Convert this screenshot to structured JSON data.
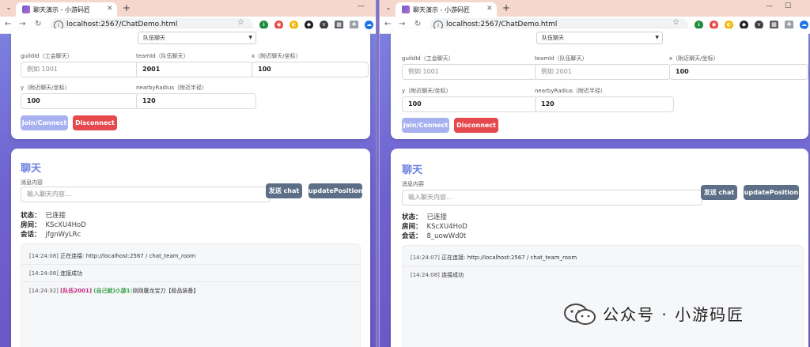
{
  "left": {
    "tab_title": "聊天演示 - 小游码匠",
    "url": "localhost:2567/ChatDemo.html",
    "form": {
      "channel_value": "队伍聊天",
      "guild_label": "guildId（工会聊天）",
      "guild_placeholder": "例如 1001",
      "team_label": "teamId（队伍聊天）",
      "team_value": "2001",
      "x_label": "x（附近聊天/坐标）",
      "x_value": "100",
      "y_label": "y（附近聊天/坐标）",
      "y_value": "100",
      "radius_label": "nearbyRadius（附近半径）",
      "radius_value": "120",
      "join_label": "Join/Connect",
      "disconnect_label": "Disconnect"
    },
    "chat": {
      "title": "聊天",
      "msg_label": "消息内容",
      "msg_placeholder": "输入聊天内容...",
      "send_label": "发送 chat",
      "update_label": "updatePosition",
      "status_key": "状态：",
      "status_val": "已连接",
      "room_key": "房间：",
      "room_val": "KScXU4HoD",
      "session_key": "会话：",
      "session_val": "jfgnWyLRc",
      "logs": [
        {
          "ts": "[14:24:08]",
          "text": "正在连接: http://localhost:2567 / chat_team_room"
        },
        {
          "ts": "[14:24:08]",
          "text": "连接成功"
        },
        {
          "ts": "[14:24:32]",
          "team": "[队伍2001]",
          "user": "(自己就)小游1:",
          "text": "刚刚屠龙宝刀【极品装备】"
        }
      ]
    }
  },
  "right": {
    "tab_title": "聊天演示 - 小游码匠",
    "url": "localhost:2567/ChatDemo.html",
    "form": {
      "channel_value": "队伍聊天",
      "guild_label": "guildId（工会聊天）",
      "guild_placeholder": "例如 1001",
      "team_label": "teamId（队伍聊天）",
      "team_placeholder": "例如 2001",
      "x_label": "x（附近聊天/坐标）",
      "x_value": "100",
      "y_label": "y（附近聊天/坐标）",
      "y_value": "100",
      "radius_label": "nearbyRadius（附近半径）",
      "radius_value": "120",
      "join_label": "Join/Connect",
      "disconnect_label": "Disconnect"
    },
    "chat": {
      "title": "聊天",
      "msg_label": "消息内容",
      "msg_placeholder": "输入聊天内容...",
      "send_label": "发送 chat",
      "update_label": "updatePosition",
      "status_key": "状态：",
      "status_val": "已连接",
      "room_key": "房间：",
      "room_val": "KScXU4HoD",
      "session_key": "会话：",
      "session_val": "8_uowWd0t",
      "logs": [
        {
          "ts": "[14:24:07]",
          "text": "正在连接: http://localhost:2567 / chat_team_room"
        },
        {
          "ts": "[14:24:08]",
          "text": "连接成功"
        }
      ]
    }
  },
  "watermark": "公众号 · 小游码匠",
  "colors": {
    "accent": "#6b7fe0",
    "join": "#a7b1f0",
    "disconnect": "#e5484d",
    "action": "#5d6f86",
    "tabbar": "#f6d7cd",
    "team": "#c0237c",
    "user": "#2f9e44"
  }
}
